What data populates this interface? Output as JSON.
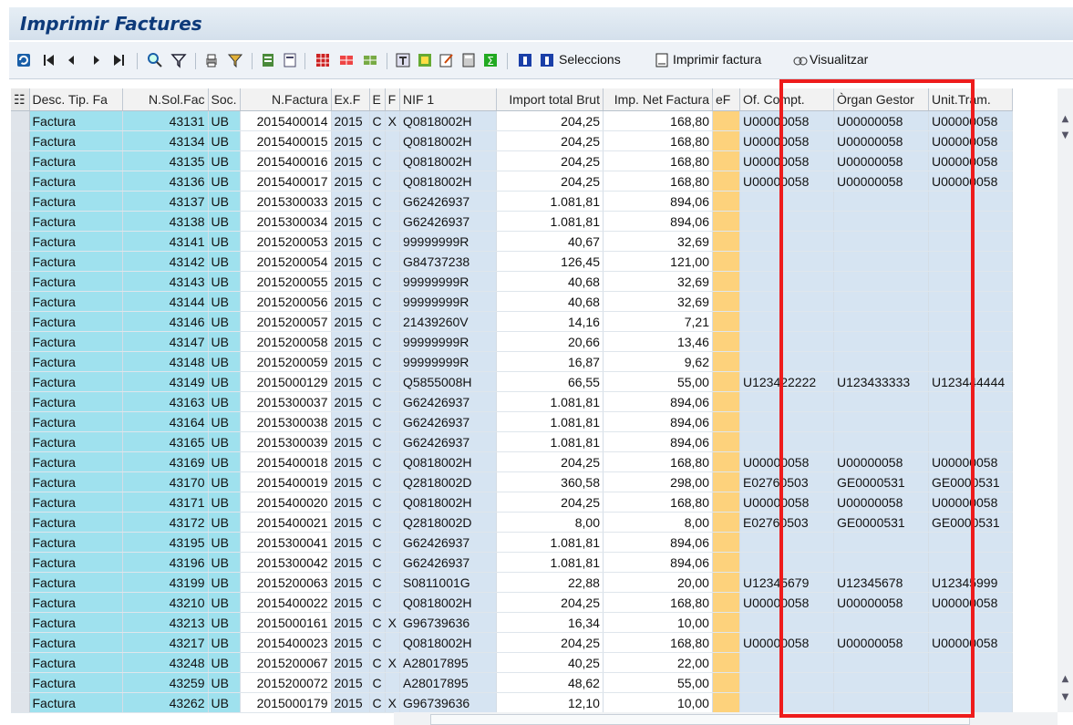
{
  "window": {
    "title": "Imprimir Factures"
  },
  "toolbar": {
    "selections_label": "Seleccions",
    "print_label": "Imprimir factura",
    "view_label": "Visualitzar",
    "icons": [
      "refresh-icon",
      "first-page-icon",
      "prev-page-icon",
      "next-page-icon",
      "last-page-icon",
      "find-icon",
      "filter-icon",
      "print-icon",
      "print-settings-icon",
      "export-icon",
      "export-local-icon",
      "layout-icon",
      "layout-change-icon",
      "layout-save-icon",
      "subtotal-icon",
      "details-icon",
      "edit-icon",
      "calc-icon",
      "sum-icon",
      "info-icon",
      "selections-icon"
    ]
  },
  "table": {
    "columns": [
      "Desc. Tip. Fa",
      "N.Sol.Fac",
      "Soc.",
      "N.Factura",
      "Ex.F",
      "E",
      "F",
      "NIF 1",
      "Import total Brut",
      "Imp. Net Factura",
      "eF",
      "Of. Compt.",
      "Òrgan Gestor",
      "Unit.Tram."
    ],
    "rows": [
      [
        "Factura",
        "43131",
        "UB",
        "2015400014",
        "2015",
        "C",
        "X",
        "Q0818002H",
        "204,25",
        "168,80",
        "",
        "U00000058",
        "U00000058",
        "U00000058"
      ],
      [
        "Factura",
        "43134",
        "UB",
        "2015400015",
        "2015",
        "C",
        "",
        "Q0818002H",
        "204,25",
        "168,80",
        "",
        "U00000058",
        "U00000058",
        "U00000058"
      ],
      [
        "Factura",
        "43135",
        "UB",
        "2015400016",
        "2015",
        "C",
        "",
        "Q0818002H",
        "204,25",
        "168,80",
        "",
        "U00000058",
        "U00000058",
        "U00000058"
      ],
      [
        "Factura",
        "43136",
        "UB",
        "2015400017",
        "2015",
        "C",
        "",
        "Q0818002H",
        "204,25",
        "168,80",
        "",
        "U00000058",
        "U00000058",
        "U00000058"
      ],
      [
        "Factura",
        "43137",
        "UB",
        "2015300033",
        "2015",
        "C",
        "",
        "G62426937",
        "1.081,81",
        "894,06",
        "",
        "",
        "",
        ""
      ],
      [
        "Factura",
        "43138",
        "UB",
        "2015300034",
        "2015",
        "C",
        "",
        "G62426937",
        "1.081,81",
        "894,06",
        "",
        "",
        "",
        ""
      ],
      [
        "Factura",
        "43141",
        "UB",
        "2015200053",
        "2015",
        "C",
        "",
        "99999999R",
        "40,67",
        "32,69",
        "",
        "",
        "",
        ""
      ],
      [
        "Factura",
        "43142",
        "UB",
        "2015200054",
        "2015",
        "C",
        "",
        "G84737238",
        "126,45",
        "121,00",
        "",
        "",
        "",
        ""
      ],
      [
        "Factura",
        "43143",
        "UB",
        "2015200055",
        "2015",
        "C",
        "",
        "99999999R",
        "40,68",
        "32,69",
        "",
        "",
        "",
        ""
      ],
      [
        "Factura",
        "43144",
        "UB",
        "2015200056",
        "2015",
        "C",
        "",
        "99999999R",
        "40,68",
        "32,69",
        "",
        "",
        "",
        ""
      ],
      [
        "Factura",
        "43146",
        "UB",
        "2015200057",
        "2015",
        "C",
        "",
        "21439260V",
        "14,16",
        "7,21",
        "",
        "",
        "",
        ""
      ],
      [
        "Factura",
        "43147",
        "UB",
        "2015200058",
        "2015",
        "C",
        "",
        "99999999R",
        "20,66",
        "13,46",
        "",
        "",
        "",
        ""
      ],
      [
        "Factura",
        "43148",
        "UB",
        "2015200059",
        "2015",
        "C",
        "",
        "99999999R",
        "16,87",
        "9,62",
        "",
        "",
        "",
        ""
      ],
      [
        "Factura",
        "43149",
        "UB",
        "2015000129",
        "2015",
        "C",
        "",
        "Q5855008H",
        "66,55",
        "55,00",
        "",
        "U123422222",
        "U123433333",
        "U123444444"
      ],
      [
        "Factura",
        "43163",
        "UB",
        "2015300037",
        "2015",
        "C",
        "",
        "G62426937",
        "1.081,81",
        "894,06",
        "",
        "",
        "",
        ""
      ],
      [
        "Factura",
        "43164",
        "UB",
        "2015300038",
        "2015",
        "C",
        "",
        "G62426937",
        "1.081,81",
        "894,06",
        "",
        "",
        "",
        ""
      ],
      [
        "Factura",
        "43165",
        "UB",
        "2015300039",
        "2015",
        "C",
        "",
        "G62426937",
        "1.081,81",
        "894,06",
        "",
        "",
        "",
        ""
      ],
      [
        "Factura",
        "43169",
        "UB",
        "2015400018",
        "2015",
        "C",
        "",
        "Q0818002H",
        "204,25",
        "168,80",
        "",
        "U00000058",
        "U00000058",
        "U00000058"
      ],
      [
        "Factura",
        "43170",
        "UB",
        "2015400019",
        "2015",
        "C",
        "",
        "Q2818002D",
        "360,58",
        "298,00",
        "",
        "E02760503",
        "GE0000531",
        "GE0000531"
      ],
      [
        "Factura",
        "43171",
        "UB",
        "2015400020",
        "2015",
        "C",
        "",
        "Q0818002H",
        "204,25",
        "168,80",
        "",
        "U00000058",
        "U00000058",
        "U00000058"
      ],
      [
        "Factura",
        "43172",
        "UB",
        "2015400021",
        "2015",
        "C",
        "",
        "Q2818002D",
        "8,00",
        "8,00",
        "",
        "E02760503",
        "GE0000531",
        "GE0000531"
      ],
      [
        "Factura",
        "43195",
        "UB",
        "2015300041",
        "2015",
        "C",
        "",
        "G62426937",
        "1.081,81",
        "894,06",
        "",
        "",
        "",
        ""
      ],
      [
        "Factura",
        "43196",
        "UB",
        "2015300042",
        "2015",
        "C",
        "",
        "G62426937",
        "1.081,81",
        "894,06",
        "",
        "",
        "",
        ""
      ],
      [
        "Factura",
        "43199",
        "UB",
        "2015200063",
        "2015",
        "C",
        "",
        "S0811001G",
        "22,88",
        "20,00",
        "",
        "U12345679",
        "U12345678",
        "U12345999"
      ],
      [
        "Factura",
        "43210",
        "UB",
        "2015400022",
        "2015",
        "C",
        "",
        "Q0818002H",
        "204,25",
        "168,80",
        "",
        "U00000058",
        "U00000058",
        "U00000058"
      ],
      [
        "Factura",
        "43213",
        "UB",
        "2015000161",
        "2015",
        "C",
        "X",
        "G96739636",
        "16,34",
        "10,00",
        "",
        "",
        "",
        ""
      ],
      [
        "Factura",
        "43217",
        "UB",
        "2015400023",
        "2015",
        "C",
        "",
        "Q0818002H",
        "204,25",
        "168,80",
        "",
        "U00000058",
        "U00000058",
        "U00000058"
      ],
      [
        "Factura",
        "43248",
        "UB",
        "2015200067",
        "2015",
        "C",
        "X",
        "A28017895",
        "40,25",
        "22,00",
        "",
        "",
        "",
        ""
      ],
      [
        "Factura",
        "43259",
        "UB",
        "2015200072",
        "2015",
        "C",
        "",
        "A28017895",
        "48,62",
        "55,00",
        "",
        "",
        "",
        ""
      ],
      [
        "Factura",
        "43262",
        "UB",
        "2015000179",
        "2015",
        "C",
        "X",
        "G96739636",
        "12,10",
        "10,00",
        "",
        "",
        "",
        ""
      ]
    ]
  },
  "colors": {
    "highlight": "#ee1c1c",
    "cyan": "#9fe1ee",
    "light_blue": "#d6e4f2",
    "ef_orange": "#fdd27c",
    "title": "#0d3a7a"
  }
}
